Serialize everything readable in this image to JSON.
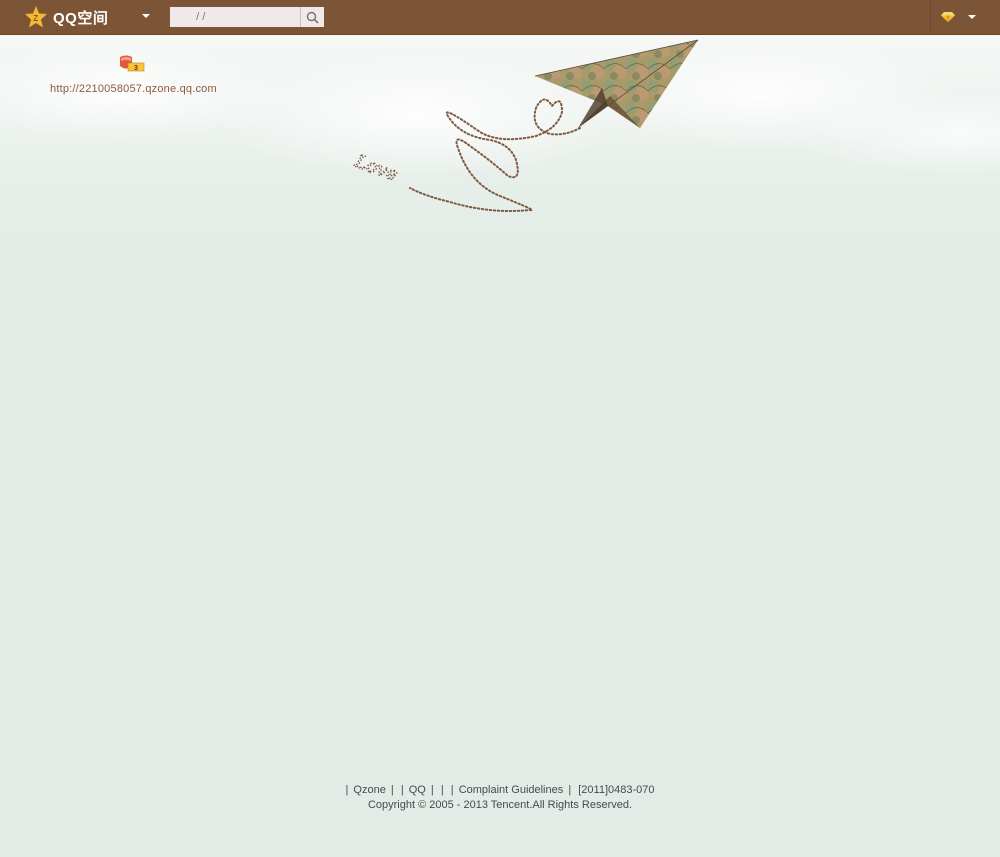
{
  "topbar": {
    "logo_text": "QQ空间",
    "search_placeholder": "  / /",
    "colors": {
      "bar": "#7c5536",
      "logo_star": "#f5b92e"
    }
  },
  "profile": {
    "level_badge_text": "3",
    "url": "http://2210058057.qzone.qq.com"
  },
  "illustration": {
    "love_text": "Love"
  },
  "footer": {
    "links": [
      {
        "sep_before": "|",
        "label": "Qzone"
      },
      {
        "sep_before": "|",
        "label": ""
      },
      {
        "sep_before": "|",
        "label": "QQ"
      },
      {
        "sep_before": "|",
        "label": ""
      },
      {
        "sep_before": "|",
        "label": ""
      },
      {
        "sep_before": "|",
        "label": ""
      },
      {
        "sep_before": "|",
        "label": "Complaint Guidelines"
      },
      {
        "sep_before": "|",
        "label": "[2011]0483-070"
      }
    ],
    "copyright": "Copyright © 2005 - 2013 Tencent.All Rights Reserved."
  }
}
